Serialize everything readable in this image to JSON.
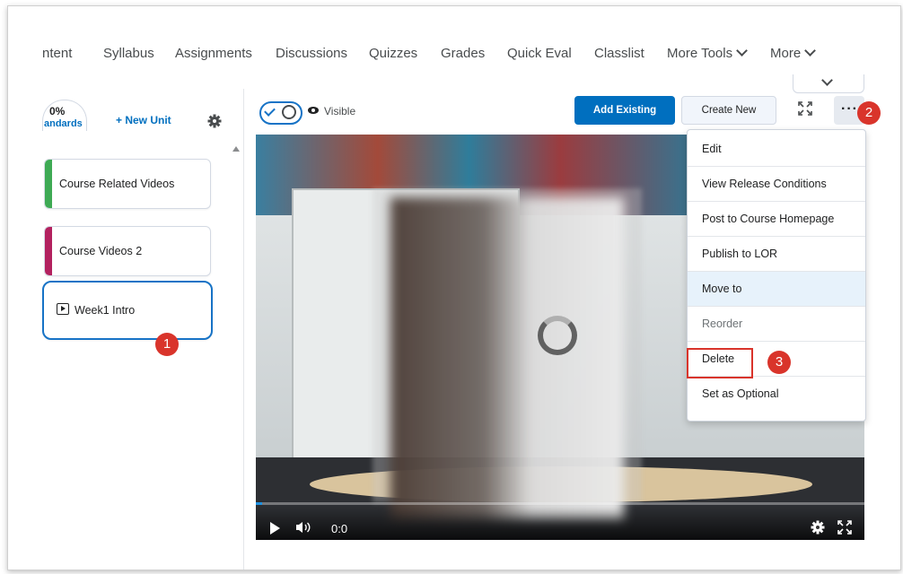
{
  "nav": {
    "items": [
      "ntent",
      "Syllabus",
      "Assignments",
      "Discussions",
      "Quizzes",
      "Grades",
      "Quick Eval",
      "Classlist",
      "More Tools",
      "More"
    ]
  },
  "left_panel": {
    "progress_value": "0%",
    "progress_label": "andards",
    "new_unit": "+ New Unit",
    "units": [
      {
        "label": "Course Related Videos",
        "color": "#3eaa54"
      },
      {
        "label": "Course Videos 2",
        "color": "#b3215f"
      },
      {
        "label": "Week1 Intro",
        "selected": true
      }
    ]
  },
  "toolbar": {
    "visible_label": "Visible",
    "add_existing": "Add Existing",
    "create_new": "Create New",
    "more_label": "···"
  },
  "video": {
    "time": "0:0",
    "progress_fraction": 0.01
  },
  "menu": {
    "items": [
      "Edit",
      "View Release Conditions",
      "Post to Course Homepage",
      "Publish to LOR",
      "Move to",
      "Reorder",
      "Delete",
      "Set as Optional"
    ]
  },
  "badges": [
    "1",
    "2",
    "3"
  ],
  "colors": {
    "accent": "#006fbf",
    "badge": "#d9342b",
    "selected_border": "#1773c6"
  }
}
